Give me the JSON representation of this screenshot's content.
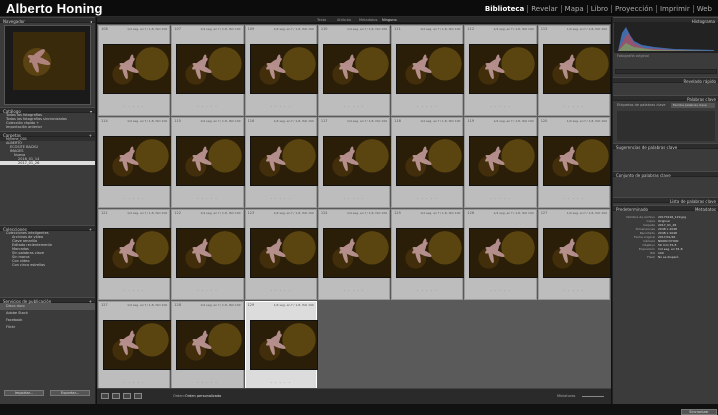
{
  "app": {
    "brand": "Alberto Honing"
  },
  "modules": [
    "Biblioteca",
    "Revelar",
    "Mapa",
    "Libro",
    "Proyección",
    "Imprimir",
    "Web"
  ],
  "left_panel": {
    "navigator": {
      "title": "Navegador"
    },
    "catalog": {
      "title": "Catálogo",
      "items": [
        "Todas las fotografías",
        "Todas las fotografías sincronizadas",
        "Colección rápida +",
        "Importación anterior"
      ]
    },
    "folders": {
      "title": "Carpetas",
      "volume": "Mylene_001",
      "items": [
        "ALBERTO",
        "ECOSITE BACKU",
        "IMAGES",
        "Nueva",
        "2016_01_14",
        "2017_01_26"
      ],
      "selected": "2017_01_26"
    },
    "collections": {
      "title": "Colecciones",
      "items": [
        "Colecciones inteligentes",
        "Archivos de vídeo",
        "Clave amarillo",
        "Editado recientemente",
        "Marcadas",
        "Sin palabras clave",
        "Sin marca",
        "Con vídeo",
        "Con cinco estrellas"
      ]
    },
    "publish": {
      "title": "Servicios de publicación",
      "items": [
        "Disco duro",
        "Adobe Stock",
        "Facebook",
        "Flickr"
      ]
    },
    "import_btn": "Importar...",
    "export_btn": "Exportar..."
  },
  "filters": {
    "items": [
      "Texto",
      "Atributo",
      "Metadatos",
      "Ninguno"
    ]
  },
  "grid": {
    "meta": "1/4 seg. en f / 1,8, ISO 100",
    "numbers": [
      108,
      107,
      109,
      110,
      111,
      112,
      113,
      114,
      115,
      116,
      117,
      118,
      119,
      120,
      121,
      122,
      123,
      124,
      125,
      126,
      127,
      127,
      128,
      129
    ],
    "selected_index": 23
  },
  "toolbar": {
    "sort_label": "Orden:",
    "sort_value": "Orden personalizado",
    "thumb_label": "Miniaturas"
  },
  "right_panel": {
    "histogram": {
      "title": "Histograma",
      "original": "Fotografía original"
    },
    "quick_develop": {
      "title": "Revelado rápido"
    },
    "keywords": {
      "title": "Palabras clave",
      "add_label": "Etiquetas de palabras clave",
      "hint": "Escriba palabras clave"
    },
    "keyword_list": {
      "title": "Lista de palabras clave"
    },
    "metadata": {
      "title": "Metadatos",
      "preset": "Predeterminado",
      "rows": [
        {
          "k": "Nombre de archivo",
          "v": "20170126_129.jpg"
        },
        {
          "k": "Copia",
          "v": "Original"
        },
        {
          "k": "Carpeta",
          "v": "2017_01_26"
        },
        {
          "k": "Dimensiones",
          "v": "2048 x 2048"
        },
        {
          "k": "Recortado",
          "v": "2048 x 2048"
        },
        {
          "k": "Fecha original",
          "v": "2017/01/26"
        },
        {
          "k": "Cámara",
          "v": "NIKON D7000"
        },
        {
          "k": "Objetivo",
          "v": "50 mm f/1.8"
        },
        {
          "k": "Exposición",
          "v": "1/4 seg. en f/1,8"
        },
        {
          "k": "ISO",
          "v": "100"
        },
        {
          "k": "Flash",
          "v": "No se disparó"
        }
      ]
    },
    "sync_btn": "Sincronizar"
  },
  "colors": {
    "bg": "#3b3b3b",
    "grid_bg": "#5a5a5a",
    "cell": "#bdbdbd"
  }
}
